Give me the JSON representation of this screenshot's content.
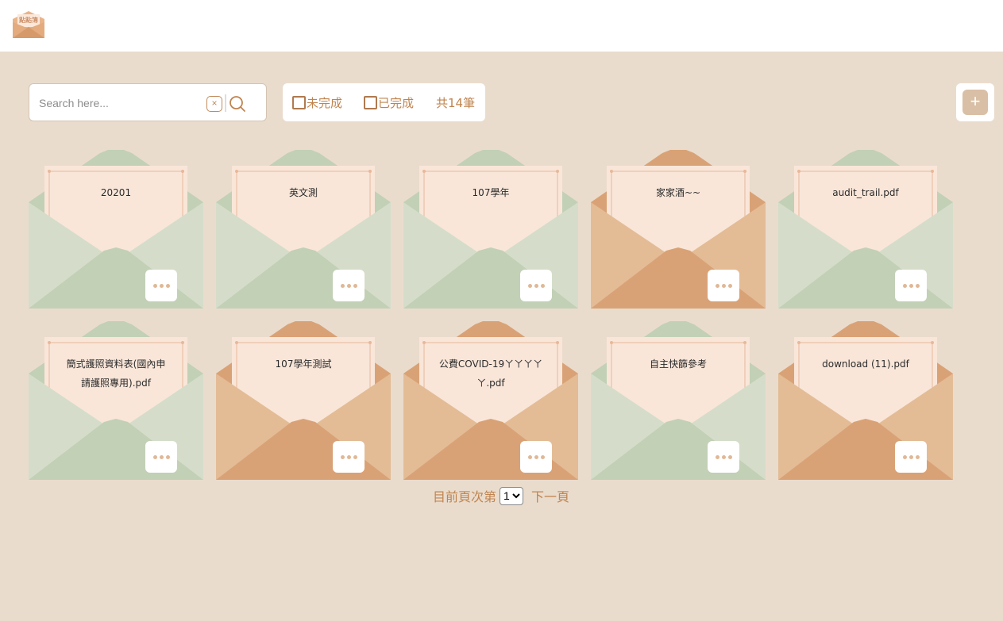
{
  "header": {
    "logo_text": "點點簿"
  },
  "search": {
    "placeholder": "Search here...",
    "value": "",
    "clear_label": "×"
  },
  "filters": {
    "incomplete_label": "未完成",
    "complete_label": "已完成",
    "total_label": "共14筆"
  },
  "add_label": "+",
  "cards": [
    {
      "title": "20201",
      "color": "green"
    },
    {
      "title": "英文測",
      "color": "green"
    },
    {
      "title": "107學年",
      "color": "green"
    },
    {
      "title": "家家酒~~",
      "color": "orange"
    },
    {
      "title": "audit_trail.pdf",
      "color": "green"
    },
    {
      "title": "簡式護照資料表(國內申請護照專用).pdf",
      "color": "green"
    },
    {
      "title": "107學年測試",
      "color": "orange"
    },
    {
      "title": "公費COVID-19ㄚㄚㄚㄚㄚ.pdf",
      "color": "orange"
    },
    {
      "title": "自主快篩參考",
      "color": "green"
    },
    {
      "title": "download (11).pdf",
      "color": "orange"
    }
  ],
  "pager": {
    "prefix": "目前頁次第",
    "current_page": "1",
    "next_label": "下一頁"
  },
  "palette": {
    "green": {
      "flap": "#c2d0b6",
      "body": "#d5ddca",
      "front": "#c2d0b6"
    },
    "orange": {
      "flap": "#d9a276",
      "body": "#e3bc96",
      "front": "#d9a276"
    },
    "letter": "#f9e6d9",
    "letter_border": "#e8b89a"
  }
}
